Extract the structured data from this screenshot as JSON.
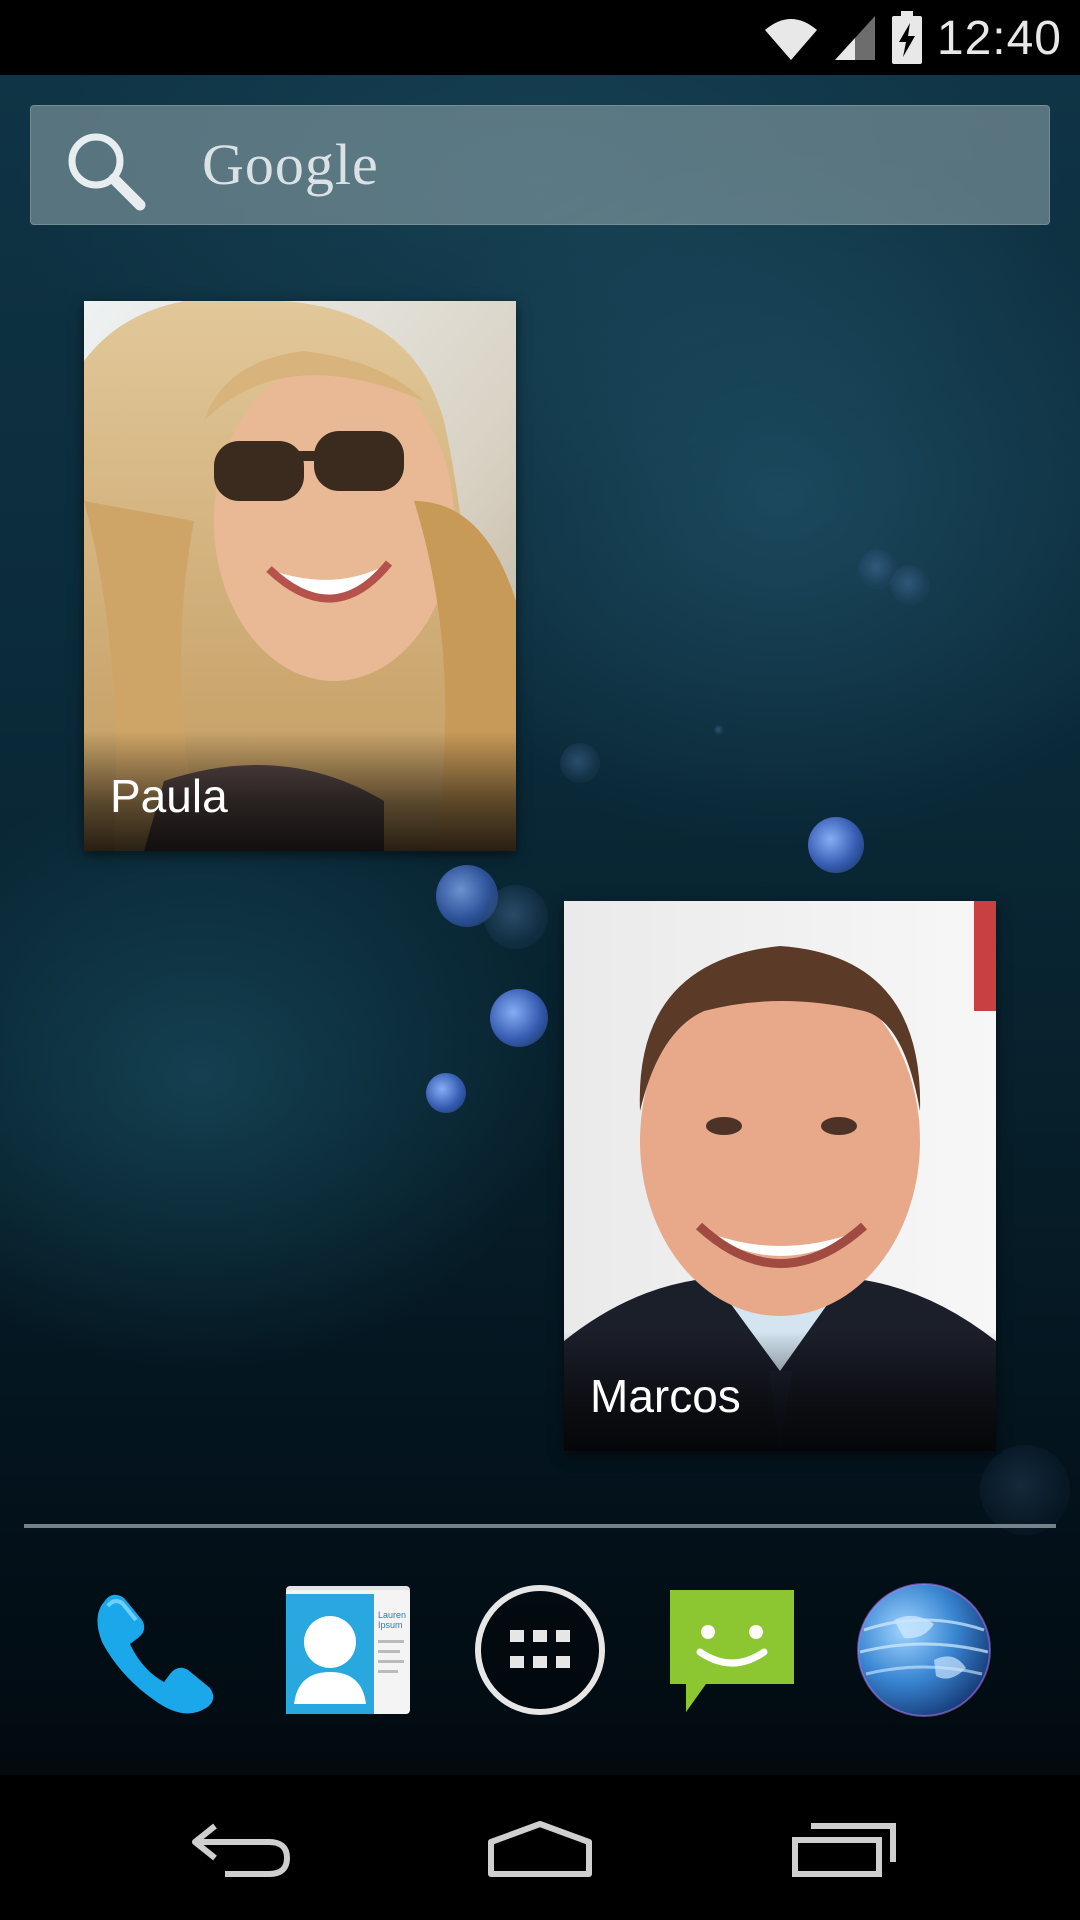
{
  "status_bar": {
    "time": "12:40",
    "icons": [
      "wifi-icon",
      "cell-signal-icon",
      "battery-charging-icon"
    ]
  },
  "search": {
    "label": "Google",
    "icon": "search-icon"
  },
  "contacts": [
    {
      "name": "Paula",
      "photo": "contact-photo-woman-sunglasses"
    },
    {
      "name": "Marcos",
      "photo": "contact-photo-man-suit"
    }
  ],
  "dock": [
    {
      "name": "phone",
      "icon": "phone-icon",
      "color": "#1aa7e8"
    },
    {
      "name": "people",
      "icon": "contacts-icon",
      "color": "#27a9e0",
      "card_text": [
        "Lauren",
        "Ipsum"
      ]
    },
    {
      "name": "apps",
      "icon": "app-drawer-icon",
      "color": "#e6e6e6"
    },
    {
      "name": "messaging",
      "icon": "messaging-icon",
      "color": "#8cc630"
    },
    {
      "name": "browser",
      "icon": "globe-icon",
      "color": "#3c8ed8"
    }
  ],
  "nav": {
    "buttons": [
      "back-icon",
      "home-icon",
      "recents-icon"
    ]
  }
}
